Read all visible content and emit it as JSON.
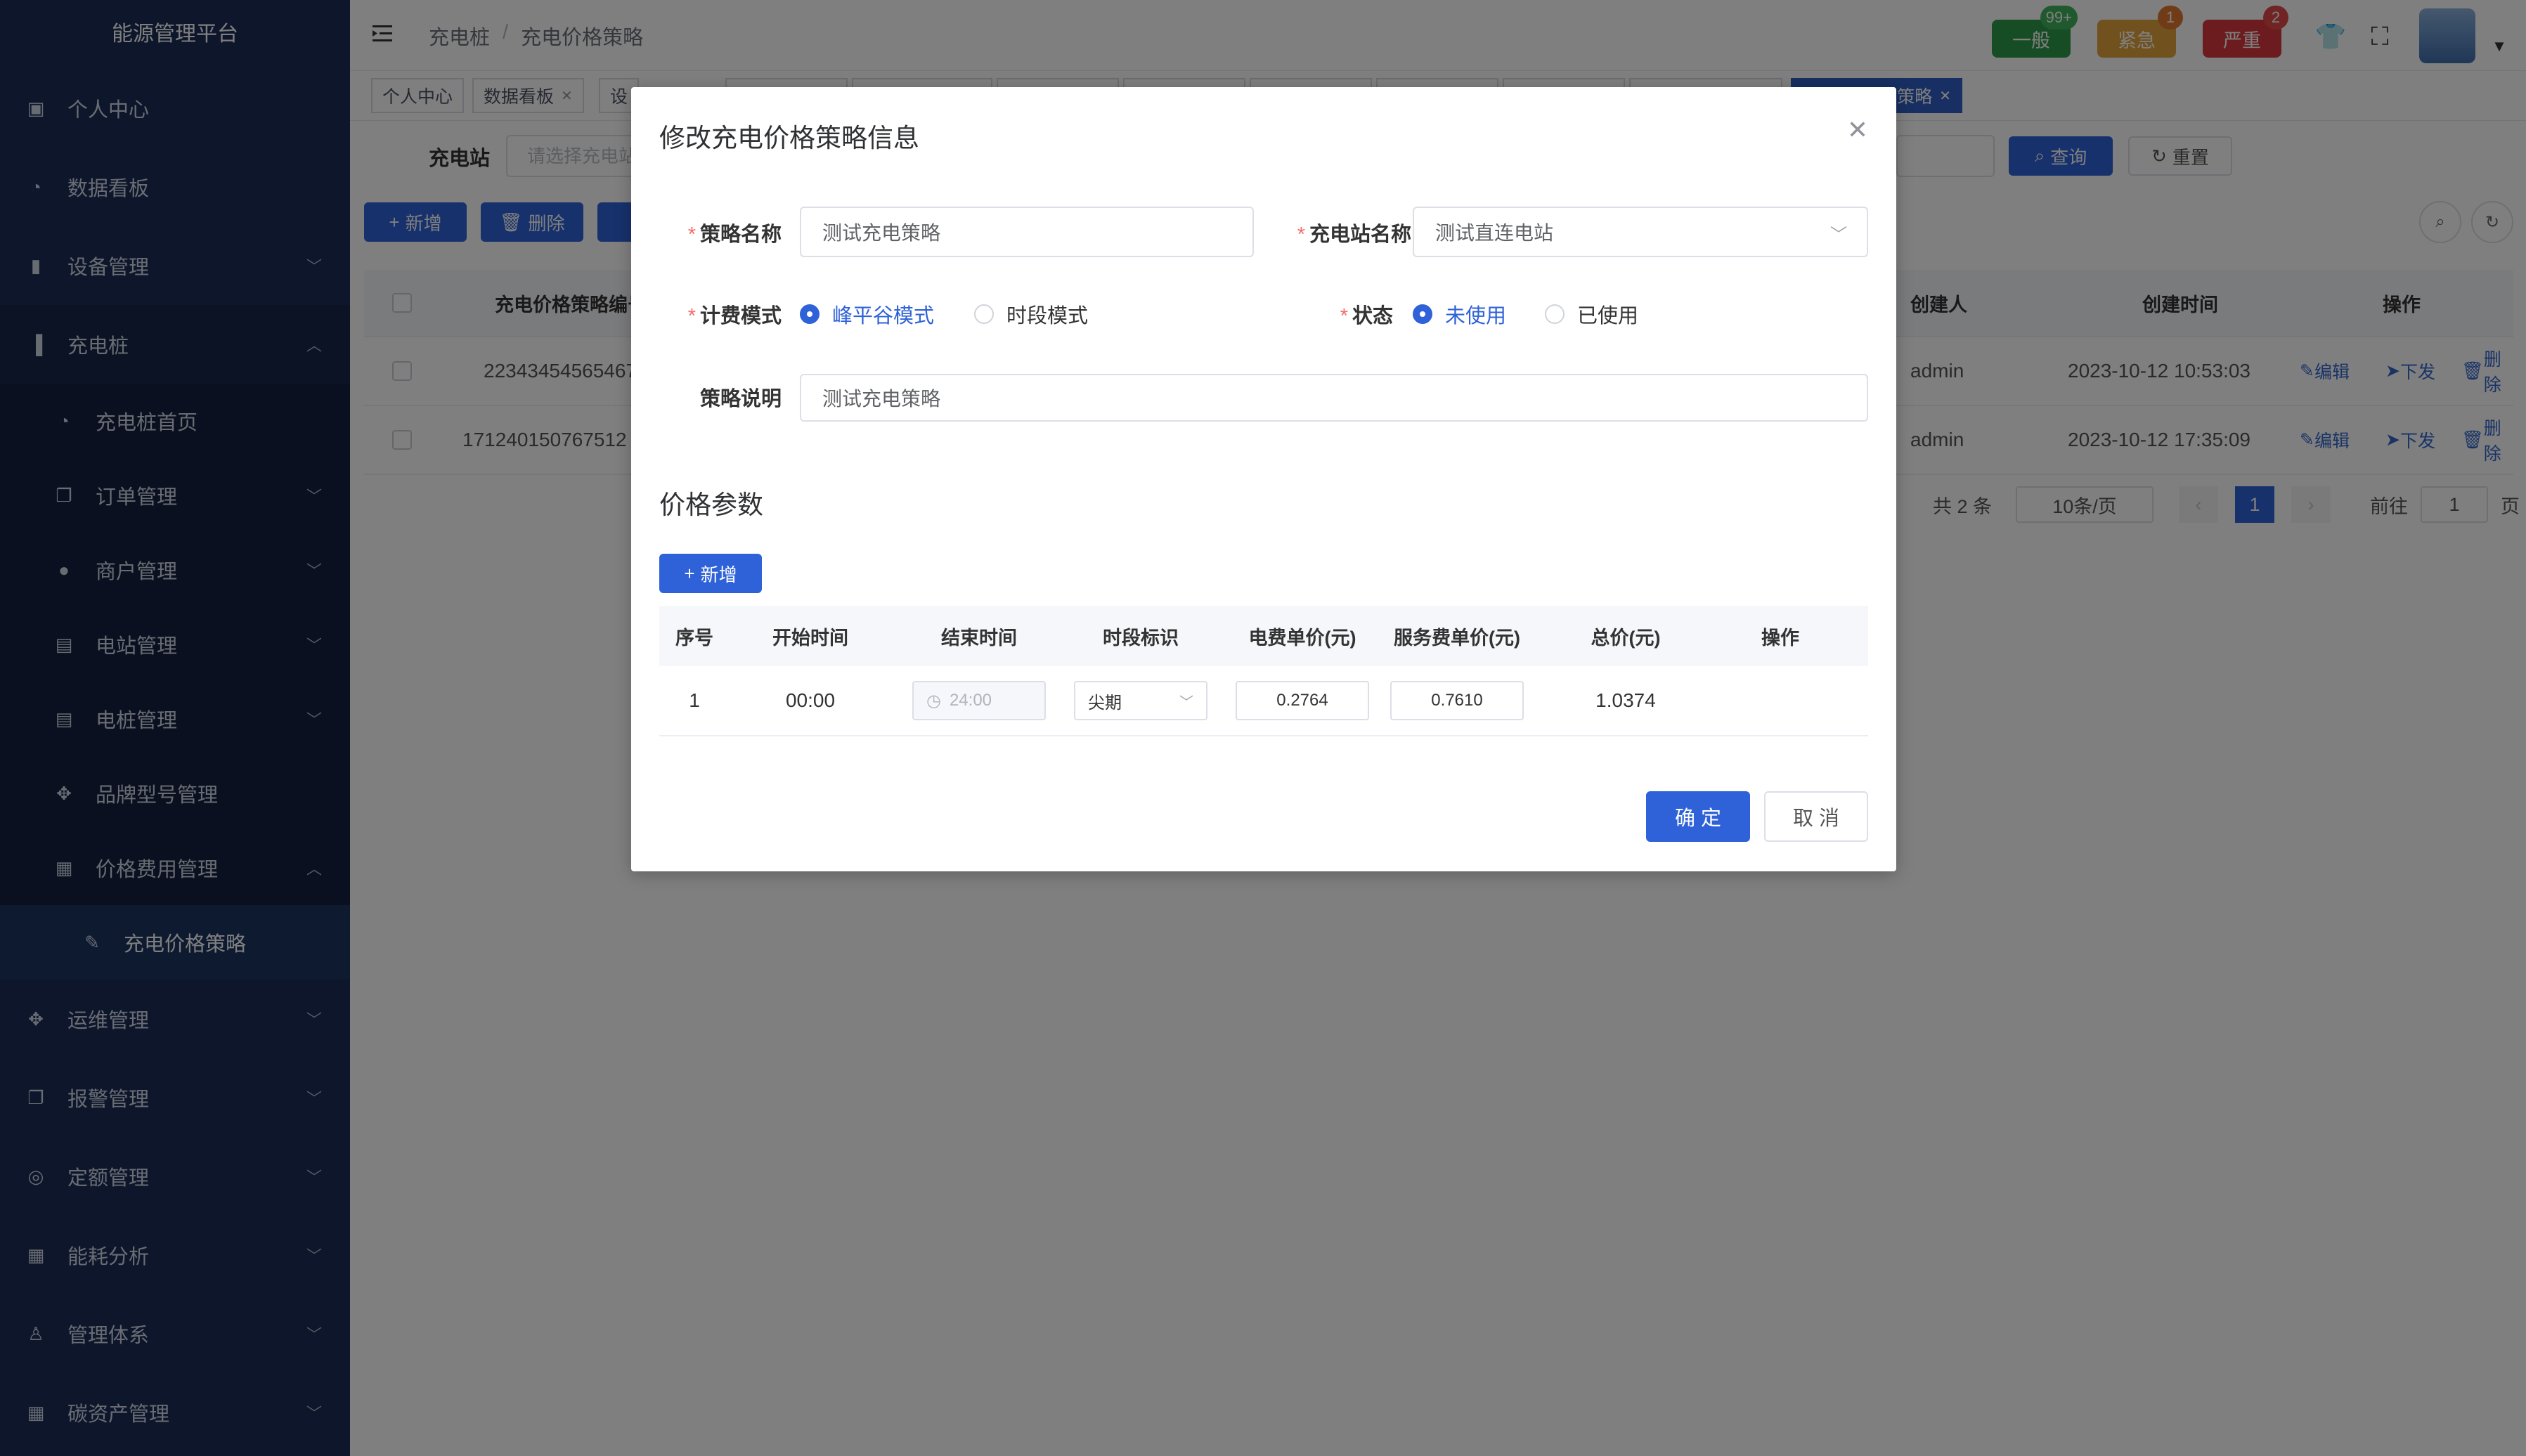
{
  "app": {
    "title": "能源管理平台"
  },
  "sidebar": {
    "items": [
      {
        "label": "个人中心",
        "icon": "id-card-icon"
      },
      {
        "label": "数据看板",
        "icon": "dashboard-icon"
      },
      {
        "label": "设备管理",
        "icon": "bar-chart-icon"
      },
      {
        "label": "充电桩",
        "icon": "charging-pile-icon"
      },
      {
        "label": "充电桩首页",
        "icon": "dashboard-icon"
      },
      {
        "label": "订单管理",
        "icon": "copy-icon"
      },
      {
        "label": "商户管理",
        "icon": "user-icon"
      },
      {
        "label": "电站管理",
        "icon": "document-icon"
      },
      {
        "label": "电桩管理",
        "icon": "document-icon"
      },
      {
        "label": "品牌型号管理",
        "icon": "puzzle-icon"
      },
      {
        "label": "价格费用管理",
        "icon": "table-icon"
      },
      {
        "label": "充电价格策略",
        "icon": "edit-icon"
      },
      {
        "label": "运维管理",
        "icon": "puzzle-icon"
      },
      {
        "label": "报警管理",
        "icon": "copy-icon"
      },
      {
        "label": "定额管理",
        "icon": "lifebuoy-icon"
      },
      {
        "label": "能耗分析",
        "icon": "grid-icon"
      },
      {
        "label": "管理体系",
        "icon": "person-walk-icon"
      },
      {
        "label": "碳资产管理",
        "icon": "table-icon"
      }
    ]
  },
  "topnav": {
    "breadcrumb": [
      "充电桩",
      "充电价格策略"
    ],
    "badges": [
      {
        "label": "一般",
        "count": "99+",
        "color": "#2e9a4b"
      },
      {
        "label": "紧急",
        "count": "1",
        "color": "#e2a33a"
      },
      {
        "label": "严重",
        "count": "2",
        "color": "#d9363e"
      }
    ]
  },
  "tags": {
    "items": [
      "个人中心",
      "数据看板",
      "设"
    ],
    "active": "策略"
  },
  "filter": {
    "label": "充电站",
    "placeholder": "请选择充电站",
    "query": "查询",
    "reset": "重置"
  },
  "toolbar": {
    "add": "新增",
    "delete": "删除"
  },
  "table": {
    "headers": [
      "充电价格策略编号",
      "创建人",
      "创建时间",
      "操作"
    ],
    "rows": [
      {
        "id": "22343454565467",
        "creator": "admin",
        "time": "2023-10-12 10:53:03"
      },
      {
        "id": "171240150767512",
        "creator": "admin",
        "time": "2023-10-12 17:35:09"
      }
    ],
    "ops": {
      "edit": "编辑",
      "issue": "下发",
      "delete": "删除"
    }
  },
  "pager": {
    "total": "共 2 条",
    "size": "10条/页",
    "page": "1",
    "goto": "前往",
    "goto_value": "1",
    "unit": "页"
  },
  "dialog": {
    "title": "修改充电价格策略信息",
    "fields": {
      "name_label": "策略名称",
      "name_value": "测试充电策略",
      "station_label": "充电站名称",
      "station_value": "测试直连电站",
      "mode_label": "计费模式",
      "mode_opt1": "峰平谷模式",
      "mode_opt2": "时段模式",
      "status_label": "状态",
      "status_opt1": "未使用",
      "status_opt2": "已使用",
      "desc_label": "策略说明",
      "desc_value": "测试充电策略"
    },
    "section_title": "价格参数",
    "add_button": "新增",
    "price_table": {
      "headers": [
        "序号",
        "开始时间",
        "结束时间",
        "时段标识",
        "电费单价(元)",
        "服务费单价(元)",
        "总价(元)",
        "操作"
      ],
      "rows": [
        {
          "index": "1",
          "start": "00:00",
          "end": "24:00",
          "period": "尖期",
          "elec": "0.2764",
          "service": "0.7610",
          "total": "1.0374"
        }
      ]
    },
    "confirm": "确 定",
    "cancel": "取 消"
  }
}
